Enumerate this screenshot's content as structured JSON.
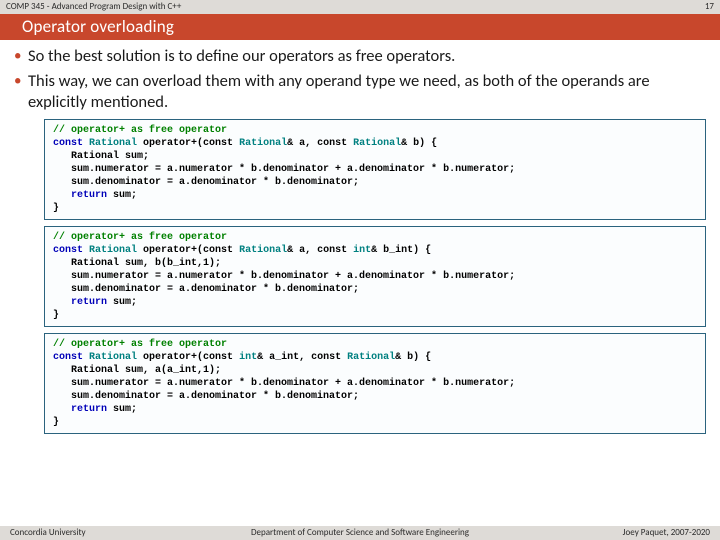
{
  "header": {
    "course": "COMP 345 - Advanced Program Design with C++",
    "page": "17",
    "title": "Operator overloading"
  },
  "bullets": [
    "So the best solution is to define our operators as free operators.",
    "This way, we can overload them with any operand type we need, as both of the operands are explicitly mentioned."
  ],
  "code": [
    {
      "comment": "// operator+ as free operator",
      "sig_pre": "const ",
      "sig_ret_type": "Rational",
      "sig_mid1": " operator+(const ",
      "sig_p1_type": "Rational",
      "sig_mid2": "& a, const ",
      "sig_p2_type": "Rational",
      "sig_end": "& b) {",
      "line_decl": "   Rational sum;",
      "line_num": "   sum.numerator = a.numerator * b.denominator + a.denominator * b.numerator;",
      "line_den": "   sum.denominator = a.denominator * b.denominator;",
      "line_ret_kw": "   return",
      "line_ret_rest": " sum;",
      "close": "}"
    },
    {
      "comment": "// operator+ as free operator",
      "sig_pre": "const ",
      "sig_ret_type": "Rational",
      "sig_mid1": " operator+(const ",
      "sig_p1_type": "Rational",
      "sig_mid2": "& a, const ",
      "sig_p2_type": "int",
      "sig_end": "& b_int) {",
      "line_decl": "   Rational sum, b(b_int,1);",
      "line_num": "   sum.numerator = a.numerator * b.denominator + a.denominator * b.numerator;",
      "line_den": "   sum.denominator = a.denominator * b.denominator;",
      "line_ret_kw": "   return",
      "line_ret_rest": " sum;",
      "close": "}"
    },
    {
      "comment": "// operator+ as free operator",
      "sig_pre": "const ",
      "sig_ret_type": "Rational",
      "sig_mid1": " operator+(const ",
      "sig_p1_type": "int",
      "sig_mid2": "& a_int, const ",
      "sig_p2_type": "Rational",
      "sig_end": "& b) {",
      "line_decl": "   Rational sum, a(a_int,1);",
      "line_num": "   sum.numerator = a.numerator * b.denominator + a.denominator * b.numerator;",
      "line_den": "   sum.denominator = a.denominator * b.denominator;",
      "line_ret_kw": "   return",
      "line_ret_rest": " sum;",
      "close": "}"
    }
  ],
  "footer": {
    "left": "Concordia University",
    "mid": "Department of Computer Science and Software Engineering",
    "right": "Joey Paquet, 2007-2020"
  }
}
